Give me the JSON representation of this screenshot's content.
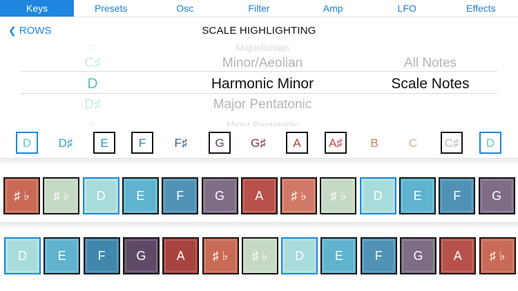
{
  "tabs": [
    {
      "label": "Keys",
      "active": true
    },
    {
      "label": "Presets",
      "active": false
    },
    {
      "label": "Osc",
      "active": false
    },
    {
      "label": "Filter",
      "active": false
    },
    {
      "label": "Amp",
      "active": false
    },
    {
      "label": "LFO",
      "active": false
    },
    {
      "label": "Effects",
      "active": false
    }
  ],
  "nav": {
    "back_label": "ROWS",
    "title": "SCALE HIGHLIGHTING"
  },
  "picker": {
    "rows": [
      {
        "key": "C",
        "scale": "Major/Ionian",
        "mode": ""
      },
      {
        "key": "C♯",
        "scale": "Minor/Aeolian",
        "mode": "All Notes"
      },
      {
        "key": "D",
        "scale": "Harmonic Minor",
        "mode": "Scale Notes"
      },
      {
        "key": "D♯",
        "scale": "Major Pentatonic",
        "mode": ""
      },
      {
        "key": "E",
        "scale": "Minor Pentatonic",
        "mode": ""
      }
    ],
    "selected_index": 2
  },
  "key_selector": [
    {
      "label": "D",
      "color": "#62c7c6",
      "boxed": true,
      "box": "#1f86e0"
    },
    {
      "label": "D♯",
      "color": "#3aa6c4",
      "boxed": false
    },
    {
      "label": "E",
      "color": "#2b95b8",
      "boxed": true,
      "box": "#151515"
    },
    {
      "label": "F",
      "color": "#2f7fa6",
      "boxed": true,
      "box": "#151515"
    },
    {
      "label": "F♯",
      "color": "#3d5e82",
      "boxed": false
    },
    {
      "label": "G",
      "color": "#5a3f5e",
      "boxed": true,
      "box": "#151515"
    },
    {
      "label": "G♯",
      "color": "#8a2f3d",
      "boxed": false
    },
    {
      "label": "A",
      "color": "#b53a35",
      "boxed": true,
      "box": "#151515"
    },
    {
      "label": "A♯",
      "color": "#c24a44",
      "boxed": true,
      "box": "#151515"
    },
    {
      "label": "B",
      "color": "#c98262",
      "boxed": false
    },
    {
      "label": "C",
      "color": "#d9a98a",
      "boxed": false
    },
    {
      "label": "C♯",
      "color": "#a9c6ab",
      "boxed": true,
      "box": "#151515"
    },
    {
      "label": "D",
      "color": "#62c7c6",
      "boxed": true,
      "box": "#1f86e0"
    }
  ],
  "colors": {
    "sharp": "#c96a56",
    "green": "#c6d9c4",
    "D": "#a8dcda",
    "E": "#5fb3cf",
    "F": "#4f92b5",
    "G": "#7e6d85",
    "A": "#b7514a",
    "sharp2": "#d27866"
  },
  "row1": [
    {
      "label": "♯ ♭",
      "color": "#c96a56",
      "root": false
    },
    {
      "label": "♯ ♭",
      "color": "#c6d9c4",
      "root": false
    },
    {
      "label": "D",
      "color": "#a8dcda",
      "root": true
    },
    {
      "label": "E",
      "color": "#5fb3cf",
      "root": false
    },
    {
      "label": "F",
      "color": "#4f92b5",
      "root": false
    },
    {
      "label": "G",
      "color": "#7e6d85",
      "root": false
    },
    {
      "label": "A",
      "color": "#b7514a",
      "root": false
    },
    {
      "label": "♯ ♭",
      "color": "#d27866",
      "root": false
    },
    {
      "label": "♯ ♭",
      "color": "#c6d9c4",
      "root": false
    },
    {
      "label": "D",
      "color": "#a8dcda",
      "root": true
    },
    {
      "label": "E",
      "color": "#5fb3cf",
      "root": false
    },
    {
      "label": "F",
      "color": "#4f92b5",
      "root": false
    },
    {
      "label": "G",
      "color": "#7e6d85",
      "root": false
    }
  ],
  "row2": [
    {
      "label": "D",
      "color": "#a8dcda",
      "root": true
    },
    {
      "label": "E",
      "color": "#5fb3cf",
      "root": false
    },
    {
      "label": "F",
      "color": "#3f87ad",
      "root": false
    },
    {
      "label": "G",
      "color": "#5e4a66",
      "root": false
    },
    {
      "label": "A",
      "color": "#a8443f",
      "root": false
    },
    {
      "label": "♯ ♭",
      "color": "#c96a56",
      "root": false
    },
    {
      "label": "♯ ♭",
      "color": "#c6d9c4",
      "root": false
    },
    {
      "label": "D",
      "color": "#a8dcda",
      "root": true
    },
    {
      "label": "E",
      "color": "#5fb3cf",
      "root": false
    },
    {
      "label": "F",
      "color": "#4f92b5",
      "root": false
    },
    {
      "label": "G",
      "color": "#7e6d85",
      "root": false
    },
    {
      "label": "A",
      "color": "#b7514a",
      "root": false
    },
    {
      "label": "♯ ♭",
      "color": "#c96a56",
      "root": false
    }
  ]
}
